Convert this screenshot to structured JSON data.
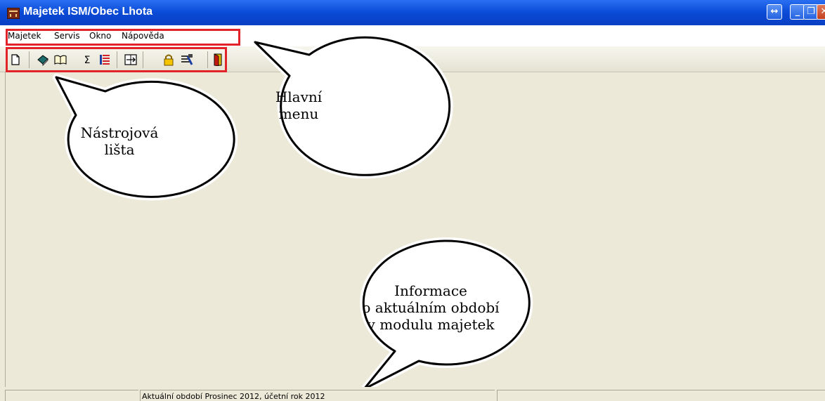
{
  "window": {
    "title": "Majetek ISM/Obec Lhota"
  },
  "menu": {
    "items": [
      "Majetek",
      "Servis",
      "Okno",
      "Nápověda"
    ]
  },
  "toolbar": {
    "icons": [
      "new-document-icon",
      "book-icon",
      "open-book-icon",
      "sum-icon",
      "list-icon",
      "navigate-icon",
      "lock-icon",
      "settings-icon",
      "exit-door-icon"
    ]
  },
  "callouts": {
    "menu": [
      "Hlavní",
      "menu"
    ],
    "toolbar": [
      "Nástrojová",
      "lišta"
    ],
    "info": [
      "Informace",
      "o aktuálním období",
      "v modulu majetek"
    ]
  },
  "status": {
    "period": "Aktuální období Prosinec 2012, účetní rok 2012"
  },
  "colors": {
    "highlight": "#e2232a",
    "titlebar": "#0a4ad6",
    "background": "#ece9d8"
  }
}
